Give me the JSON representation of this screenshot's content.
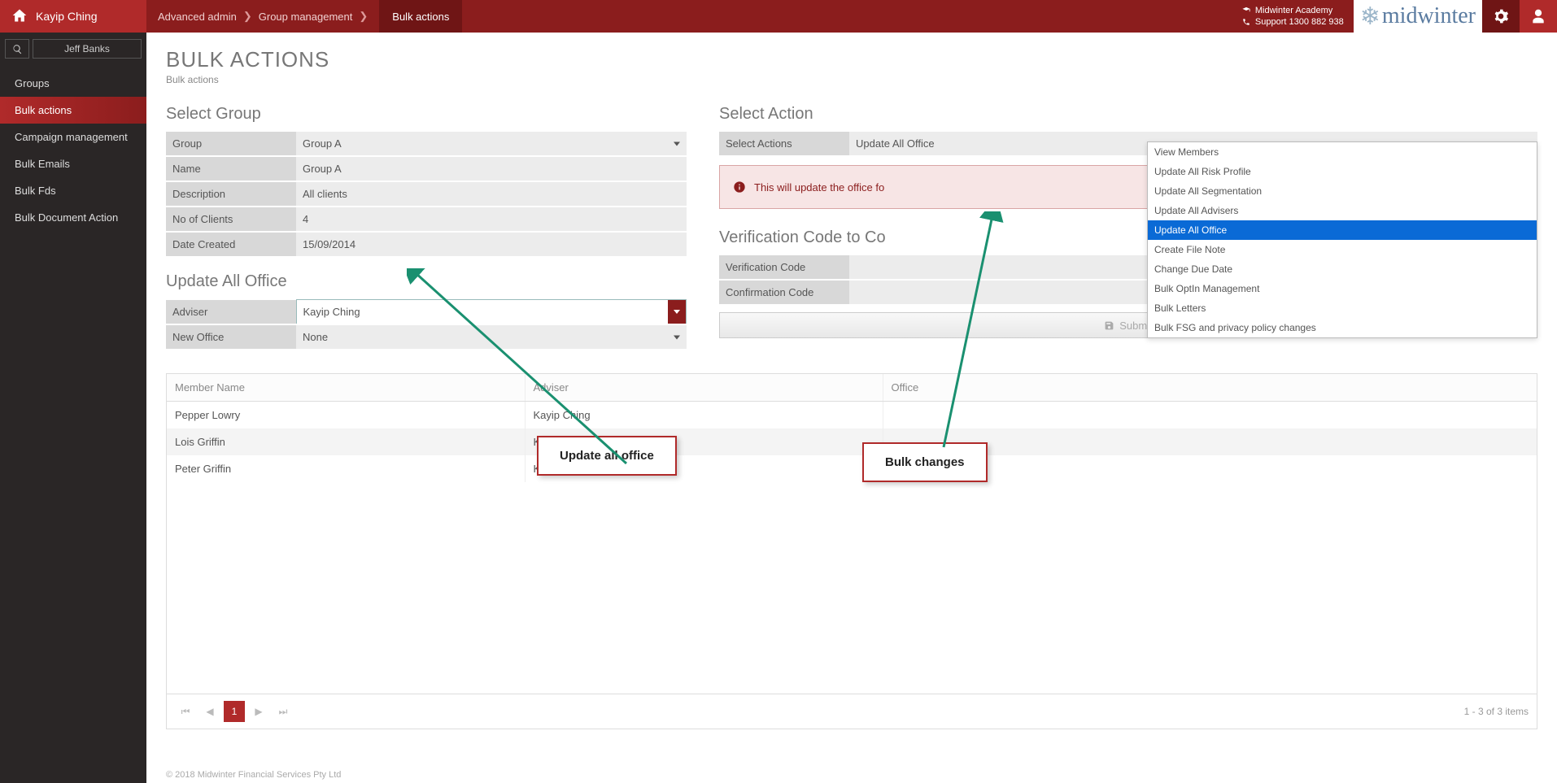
{
  "topbar": {
    "user_name": "Kayip Ching",
    "breadcrumb": [
      "Advanced admin",
      "Group management",
      "Bulk actions"
    ],
    "academy": "Midwinter Academy",
    "support": "Support 1300 882 938",
    "logo": "midwinter"
  },
  "sidebar": {
    "search_name": "Jeff Banks",
    "items": [
      {
        "label": "Groups",
        "active": false
      },
      {
        "label": "Bulk actions",
        "active": true
      },
      {
        "label": "Campaign management",
        "active": false
      },
      {
        "label": "Bulk Emails",
        "active": false
      },
      {
        "label": "Bulk Fds",
        "active": false
      },
      {
        "label": "Bulk Document Action",
        "active": false
      }
    ]
  },
  "page": {
    "title": "BULK ACTIONS",
    "subtitle": "Bulk actions"
  },
  "select_group": {
    "heading": "Select Group",
    "fields": {
      "group_label": "Group",
      "group_value": "Group A",
      "name_label": "Name",
      "name_value": "Group A",
      "desc_label": "Description",
      "desc_value": "All clients",
      "clients_label": "No of Clients",
      "clients_value": "4",
      "date_label": "Date Created",
      "date_value": "15/09/2014"
    }
  },
  "update_office": {
    "heading": "Update All Office",
    "adviser_label": "Adviser",
    "adviser_value": "Kayip Ching",
    "newoffice_label": "New Office",
    "newoffice_value": "None"
  },
  "select_action": {
    "heading": "Select Action",
    "label": "Select Actions",
    "value": "Update All Office",
    "options": [
      "View Members",
      "Update All Risk Profile",
      "Update All Segmentation",
      "Update All Advisers",
      "Update All Office",
      "Create File Note",
      "Change Due Date",
      "Bulk OptIn Management",
      "Bulk Letters",
      "Bulk FSG and privacy policy changes"
    ],
    "warning": "This will update the office fo",
    "verify_heading": "Verification Code to Co",
    "vcode_label": "Verification Code",
    "ccode_label": "Confirmation Code",
    "submit_label": "Submit"
  },
  "table": {
    "headers": [
      "Member Name",
      "Adviser",
      "Office"
    ],
    "rows": [
      {
        "name": "Pepper Lowry",
        "adviser": "Kayip Ching",
        "office": ""
      },
      {
        "name": "Lois Griffin",
        "adviser": "Kayip Ching",
        "office": ""
      },
      {
        "name": "Peter Griffin",
        "adviser": "Kayip Ching",
        "office": ""
      }
    ],
    "page": "1",
    "info": "1 - 3 of 3 items"
  },
  "footer": "© 2018 Midwinter Financial Services Pty Ltd",
  "annotations": {
    "callout1": "Update all office",
    "callout2": "Bulk changes"
  }
}
